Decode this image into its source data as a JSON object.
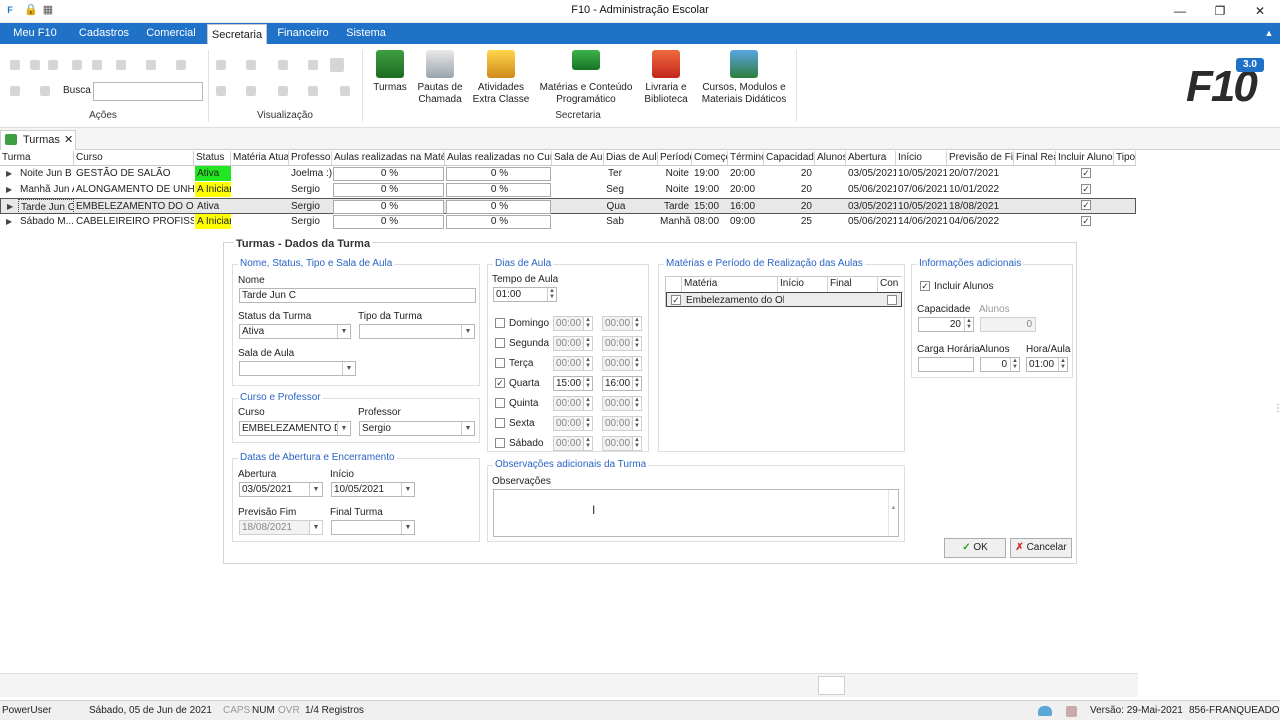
{
  "window": {
    "title": "F10 - Administração Escolar"
  },
  "menu_tabs": [
    "Meu F10",
    "Cadastros",
    "Comercial",
    "Secretaria",
    "Financeiro",
    "Sistema"
  ],
  "ribbon": {
    "search_label": "Busca",
    "search_value": "",
    "group_acoes": "Ações",
    "group_visualizacao": "Visualização",
    "group_secretaria": "Secretaria",
    "buttons": [
      {
        "label1": "Turmas",
        "label2": ""
      },
      {
        "label1": "Pautas de",
        "label2": "Chamada"
      },
      {
        "label1": "Atividades",
        "label2": "Extra Classe"
      },
      {
        "label1": "Matérias e Conteúdo",
        "label2": "Programático"
      },
      {
        "label1": "Livraria e",
        "label2": "Biblioteca"
      },
      {
        "label1": "Cursos, Modulos e",
        "label2": "Materiais Didáticos"
      }
    ],
    "logo_text": "F10",
    "logo_version": "3.0"
  },
  "doc_tab": {
    "label": "Turmas"
  },
  "grid": {
    "columns": [
      "Turma",
      "Curso",
      "Status",
      "Matéria Atual",
      "Professor",
      "Aulas realizadas na Matéria",
      "Aulas realizadas no Curso",
      "Sala de Aula",
      "Dias de Aula",
      "Período",
      "Começo",
      "Término",
      "Capacidade",
      "Alunos",
      "Abertura",
      "Início",
      "Previsão de Fim",
      "Final Real",
      "Incluir Alunos",
      "Tipo"
    ],
    "rows": [
      {
        "turma": "Noite Jun B",
        "curso": "GESTÃO DE SALÃO",
        "status": "Ativa",
        "status_color": "#22e622",
        "materia": "",
        "professor": "Joelma :)",
        "aulas_materia": "0 %",
        "aulas_curso": "0 %",
        "sala": "",
        "dias": "Ter",
        "periodo": "Noite",
        "comeco": "19:00",
        "termino": "20:00",
        "capacidade": "20",
        "alunos": "",
        "abertura": "03/05/2021",
        "inicio": "10/05/2021",
        "previsao": "20/07/2021",
        "final": "",
        "incluir": "✓",
        "tipo": ""
      },
      {
        "turma": "Manhã Jun A",
        "curso": "ALONGAMENTO DE UNHAS",
        "status": "A Iniciar",
        "status_color": "#ffff00",
        "materia": "",
        "professor": "Sergio",
        "aulas_materia": "0 %",
        "aulas_curso": "0 %",
        "sala": "",
        "dias": "Seg",
        "periodo": "Noite",
        "comeco": "19:00",
        "termino": "20:00",
        "capacidade": "20",
        "alunos": "",
        "abertura": "05/06/2021",
        "inicio": "07/06/2021",
        "previsao": "10/01/2022",
        "final": "",
        "incluir": "✓",
        "tipo": ""
      },
      {
        "turma": "Tarde Jun C",
        "curso": "EMBELEZAMENTO DO OLHAR",
        "status": "Ativa",
        "status_color": "",
        "materia": "",
        "professor": "Sergio",
        "aulas_materia": "0 %",
        "aulas_curso": "0 %",
        "sala": "",
        "dias": "Qua",
        "periodo": "Tarde",
        "comeco": "15:00",
        "termino": "16:00",
        "capacidade": "20",
        "alunos": "",
        "abertura": "03/05/2021",
        "inicio": "10/05/2021",
        "previsao": "18/08/2021",
        "final": "",
        "incluir": "✓",
        "tipo": ""
      },
      {
        "turma": "Sábado M...",
        "curso": "CABELEIREIRO PROFISSI...",
        "status": "A Iniciar",
        "status_color": "#ffff00",
        "materia": "",
        "professor": "Sergio",
        "aulas_materia": "0 %",
        "aulas_curso": "0 %",
        "sala": "",
        "dias": "Sab",
        "periodo": "Manhã",
        "comeco": "08:00",
        "termino": "09:00",
        "capacidade": "25",
        "alunos": "",
        "abertura": "05/06/2021",
        "inicio": "14/06/2021",
        "previsao": "04/06/2022",
        "final": "",
        "incluir": "✓",
        "tipo": ""
      }
    ]
  },
  "form": {
    "title": "Turmas - Dados da Turma",
    "g_nome": "Nome, Status, Tipo e Sala de Aula",
    "nome_label": "Nome",
    "nome_value": "Tarde Jun C",
    "status_label": "Status da Turma",
    "status_value": "Ativa",
    "tipo_label": "Tipo da Turma",
    "tipo_value": "",
    "sala_label": "Sala de Aula",
    "sala_value": "",
    "g_curso": "Curso e Professor",
    "curso_label": "Curso",
    "curso_value": "EMBELEZAMENTO DO O",
    "professor_label": "Professor",
    "professor_value": "Sergio",
    "g_datas": "Datas de Abertura e Encerramento",
    "abertura_label": "Abertura",
    "abertura_value": "03/05/2021",
    "inicio_label": "Início",
    "inicio_value": "10/05/2021",
    "previsao_label": "Previsão Fim",
    "previsao_value": "18/08/2021",
    "final_label": "Final Turma",
    "final_value": "",
    "g_dias": "Dias de Aula",
    "tempo_label": "Tempo de Aula",
    "tempo_value": "01:00",
    "dias": [
      {
        "nome": "Domingo",
        "checked": "",
        "ini": "00:00",
        "fim": "00:00"
      },
      {
        "nome": "Segunda",
        "checked": "",
        "ini": "00:00",
        "fim": "00:00"
      },
      {
        "nome": "Terça",
        "checked": "",
        "ini": "00:00",
        "fim": "00:00"
      },
      {
        "nome": "Quarta",
        "checked": "✓",
        "ini": "15:00",
        "fim": "16:00"
      },
      {
        "nome": "Quinta",
        "checked": "",
        "ini": "00:00",
        "fim": "00:00"
      },
      {
        "nome": "Sexta",
        "checked": "",
        "ini": "00:00",
        "fim": "00:00"
      },
      {
        "nome": "Sábado",
        "checked": "",
        "ini": "00:00",
        "fim": "00:00"
      }
    ],
    "g_materias": "Matérias e Período de Realização das Aulas",
    "mat_cols": [
      "Matéria",
      "Início",
      "Final",
      "Con"
    ],
    "mat_row": {
      "check": "✓",
      "materia": "Embelezamento do Olha"
    },
    "g_obs": "Observações adicionais da Turma",
    "obs_label": "Observações",
    "obs_value": "",
    "g_info": "Informações adicionais",
    "incluir_label": "Incluir Alunos",
    "incluir_check": "✓",
    "capacidade_label": "Capacidade",
    "capacidade_value": "20",
    "alunos_label": "Alunos",
    "alunos_value": "0",
    "carga_label": "Carga Horária",
    "carga_value": "",
    "alunos2_label": "Alunos",
    "alunos2_value": "0",
    "horaaula_label": "Hora/Aula",
    "horaaula_value": "01:00",
    "ok_label": "OK",
    "cancel_label": "Cancelar"
  },
  "statusbar": {
    "user": "PowerUser",
    "date": "Sábado, 05 de Jun de 2021",
    "caps": "CAPS",
    "num": "NUM",
    "ovr": "OVR",
    "registros": "1/4 Registros",
    "versao": "Versão: 29-Mai-2021",
    "empresa": "856-FRANQUEADORA"
  }
}
